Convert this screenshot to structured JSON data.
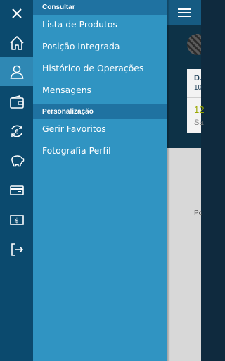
{
  "sections": [
    {
      "title": "Consultar",
      "items": [
        "Lista de Produtos",
        "Posição Integrada",
        "Histórico de Operações",
        "Mensagens"
      ]
    },
    {
      "title": "Personalização",
      "items": [
        "Gerir Favoritos",
        "Fotografia Perfil"
      ]
    }
  ],
  "rail_icons": [
    "close-icon",
    "home-icon",
    "user-icon",
    "wallet-icon",
    "euro-exchange-icon",
    "piggy-bank-icon",
    "card-icon",
    "cash-icon",
    "logout-icon"
  ],
  "background_app": {
    "name_partial": "D.",
    "line2_partial": "10",
    "amount_partial": "12",
    "label_partial": "Sa",
    "footer_partial": "Po"
  },
  "colors": {
    "rail": "#0b4a6e",
    "rail_active": "#2f88b4",
    "panel": "#3094c2",
    "section_header": "#1f72a1"
  }
}
